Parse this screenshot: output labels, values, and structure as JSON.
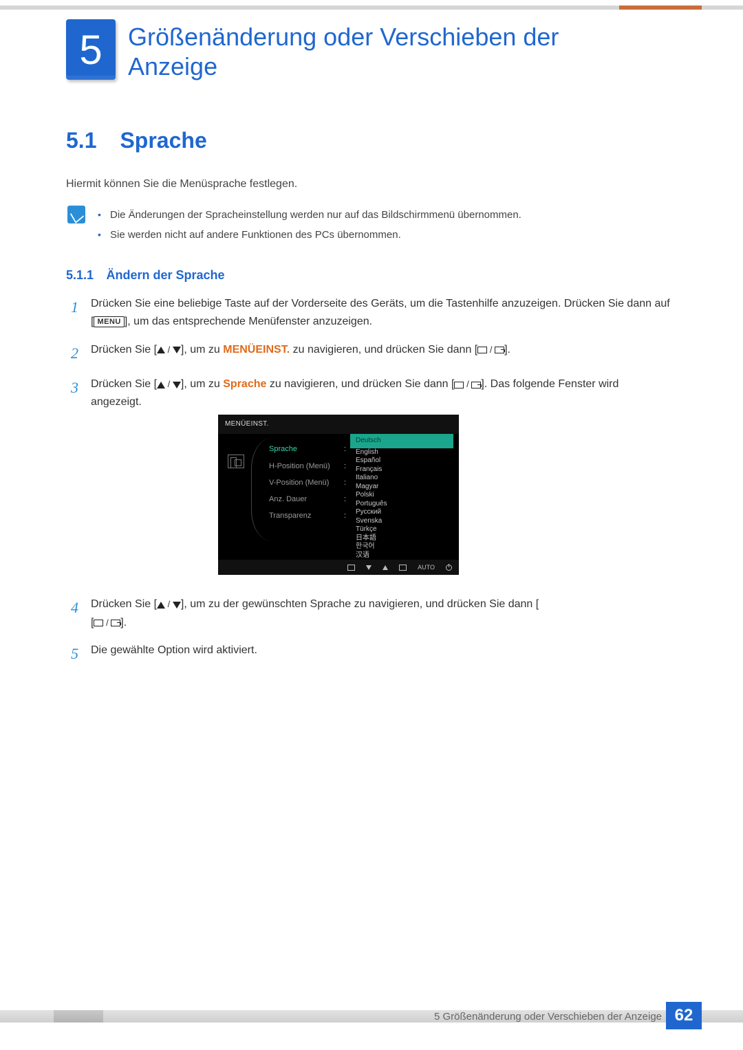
{
  "chapter": {
    "number": "5",
    "title": "Größenänderung oder Verschieben der Anzeige"
  },
  "section": {
    "number": "5.1",
    "title": "Sprache",
    "intro": "Hiermit können Sie die Menüsprache festlegen."
  },
  "notes": [
    "Die Änderungen der Spracheinstellung werden nur auf das Bildschirmmenü übernommen.",
    "Sie werden nicht auf andere Funktionen des PCs übernommen."
  ],
  "subsection": {
    "number": "5.1.1",
    "title": "Ändern der Sprache"
  },
  "menu_btn_label": "MENU",
  "steps": {
    "s1a": "Drücken Sie eine beliebige Taste auf der Vorderseite des Geräts, um die Tastenhilfe anzuzeigen. Drücken Sie dann auf [",
    "s1b": "], um das entsprechende Menüfenster anzuzeigen.",
    "s2a": "Drücken Sie [",
    "s2b": "], um zu ",
    "s2c": " zu navigieren, und drücken Sie dann [",
    "s2d": "].",
    "s2_hl": "MENÜEINST.",
    "s3a": "Drücken Sie [",
    "s3b": "], um zu ",
    "s3c": " zu navigieren, und drücken Sie dann [",
    "s3d": "]. Das folgende Fenster wird angezeigt.",
    "s3_hl": "Sprache",
    "s4a": "Drücken Sie [",
    "s4b": "], um zu der gewünschten Sprache zu navigieren, und drücken Sie dann [",
    "s4c": "].",
    "s5": "Die gewählte Option wird aktiviert."
  },
  "osd": {
    "title": "MENÜEINST.",
    "rows": [
      {
        "label": "Sprache",
        "sel": true
      },
      {
        "label": "H-Position (Menü)",
        "sel": false
      },
      {
        "label": "V-Position (Menü)",
        "sel": false
      },
      {
        "label": "Anz. Dauer",
        "sel": false
      },
      {
        "label": "Transparenz",
        "sel": false
      }
    ],
    "highlight": "Deutsch",
    "languages": [
      "English",
      "Español",
      "Français",
      "Italiano",
      "Magyar",
      "Polski",
      "Português",
      "Русский",
      "Svenska",
      "Türkçe",
      "日本語",
      "한국어",
      "汉语"
    ],
    "foot_auto": "AUTO"
  },
  "footer": {
    "text": "5 Größenänderung oder Verschieben der Anzeige",
    "page": "62"
  }
}
